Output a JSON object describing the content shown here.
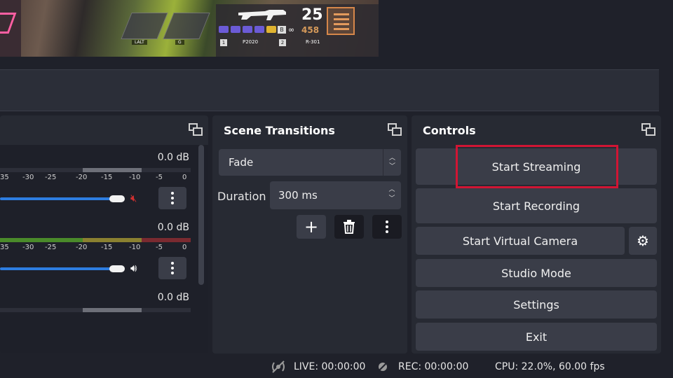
{
  "preview": {
    "hud_keys": [
      "LALT",
      "G"
    ],
    "ammo_count": "25",
    "ammo_reserve": "458",
    "slot1_num": "1",
    "slot1_name": "P2020",
    "slot2_num": "2",
    "slot2_name": "R-301",
    "badge_letter": "B"
  },
  "mixer": {
    "channels": [
      {
        "db": "0.0 dB",
        "mute_icon": "muted-speaker-icon"
      },
      {
        "db": "0.0 dB",
        "mute_icon": "speaker-icon"
      },
      {
        "db": "0.0 dB"
      }
    ],
    "ticks": [
      "35",
      "-30",
      "-25",
      "-20",
      "-15",
      "-10",
      "-5",
      "0"
    ]
  },
  "transitions": {
    "title": "Scene Transitions",
    "selected": "Fade",
    "duration_label": "Duration",
    "duration_value": "300 ms"
  },
  "controls": {
    "title": "Controls",
    "start_streaming": "Start Streaming",
    "start_recording": "Start Recording",
    "start_virtual_camera": "Start Virtual Camera",
    "studio_mode": "Studio Mode",
    "settings": "Settings",
    "exit": "Exit"
  },
  "status": {
    "live": "LIVE: 00:00:00",
    "rec": "REC: 00:00:00",
    "cpu": "CPU: 22.0%, 60.00 fps"
  },
  "colors": {
    "highlight": "#d11534",
    "fader": "#2d7de0",
    "mute": "#d03030"
  }
}
